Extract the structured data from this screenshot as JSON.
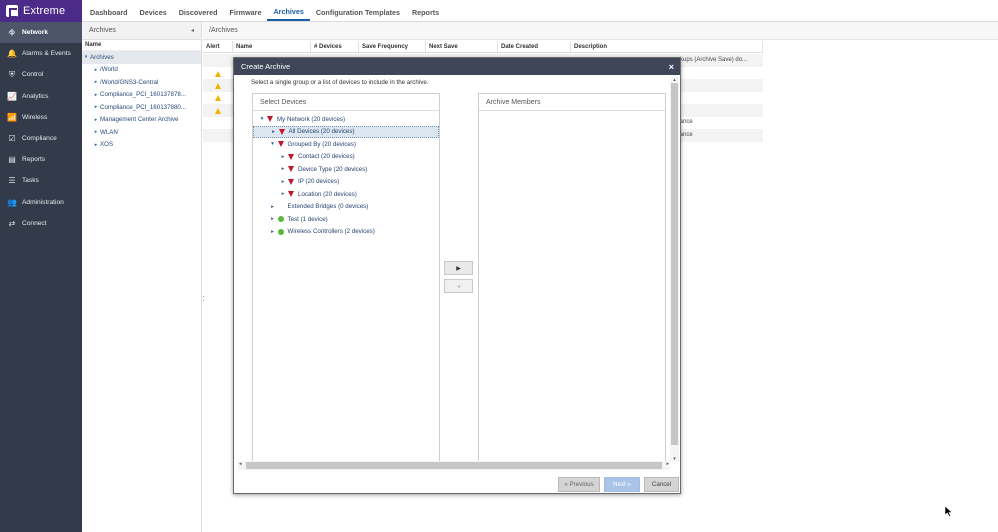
{
  "brand": {
    "name": "Extreme"
  },
  "sidebar": {
    "items": [
      {
        "label": "Network",
        "icon": "network-icon",
        "glyph": "⛗",
        "active": true
      },
      {
        "label": "Alarms & Events",
        "icon": "bell-icon",
        "glyph": "🔔",
        "active": false
      },
      {
        "label": "Control",
        "icon": "shield-icon",
        "glyph": "⛨",
        "active": false
      },
      {
        "label": "Analytics",
        "icon": "chart-icon",
        "glyph": "📈",
        "active": false
      },
      {
        "label": "Wireless",
        "icon": "wifi-icon",
        "glyph": "📶",
        "active": false
      },
      {
        "label": "Compliance",
        "icon": "check-icon",
        "glyph": "☑",
        "active": false
      },
      {
        "label": "Reports",
        "icon": "report-icon",
        "glyph": "▤",
        "active": false
      },
      {
        "label": "Tasks",
        "icon": "tasks-icon",
        "glyph": "☰",
        "active": false
      },
      {
        "label": "Administration",
        "icon": "users-icon",
        "glyph": "👥",
        "active": false
      },
      {
        "label": "Connect",
        "icon": "connect-icon",
        "glyph": "⇄",
        "active": false
      }
    ]
  },
  "top_tabs": [
    "Dashboard",
    "Devices",
    "Discovered",
    "Firmware",
    "Archives",
    "Configuration Templates",
    "Reports"
  ],
  "active_tab": "Archives",
  "archives_panel": {
    "title": "Archives",
    "collapse_glyph": "◂",
    "column": "Name",
    "root": "Archives",
    "items": [
      "/World",
      "/World/GNS3-Central",
      "Compliance_PCI_160137878...",
      "Compliance_PCI_160137880...",
      "Management Center Archive",
      "WLAN",
      "XOS"
    ]
  },
  "main": {
    "path": "/Archives",
    "columns": [
      "Alert",
      "Name",
      "# Devices",
      "Save Frequency",
      "Next Save",
      "Date Created",
      "Description"
    ],
    "visible_text": [
      "ckups (Archive Save) do...",
      "liance",
      "liance"
    ]
  },
  "modal": {
    "title": "Create Archive",
    "close_glyph": "×",
    "instruction": "Select a single group or a list of devices to include in the archive.",
    "left_header": "Select Devices",
    "right_header": "Archive Members",
    "tree": [
      {
        "label": "My Network (20 devices)",
        "level": 0,
        "arrow": "▾",
        "marker": "red"
      },
      {
        "label": "All Devices (20 devices)",
        "level": 1,
        "arrow": "▸",
        "marker": "red",
        "selected": true
      },
      {
        "label": "Grouped By (20 devices)",
        "level": 1,
        "arrow": "▾",
        "marker": "red"
      },
      {
        "label": "Contact (20 devices)",
        "level": 2,
        "arrow": "▸",
        "marker": "red"
      },
      {
        "label": "Device Type (20 devices)",
        "level": 2,
        "arrow": "▸",
        "marker": "red"
      },
      {
        "label": "IP (20 devices)",
        "level": 2,
        "arrow": "▸",
        "marker": "red"
      },
      {
        "label": "Location (20 devices)",
        "level": 2,
        "arrow": "▸",
        "marker": "red"
      },
      {
        "label": "Extended Bridges (0 devices)",
        "level": 1,
        "arrow": "▸",
        "marker": "none"
      },
      {
        "label": "Test (1 device)",
        "level": 1,
        "arrow": "▸",
        "marker": "green"
      },
      {
        "label": "Wireless Controllers (2 devices)",
        "level": 1,
        "arrow": "▸",
        "marker": "green"
      }
    ],
    "add_glyph": "▶",
    "remove_glyph": "◂",
    "buttons": {
      "previous": "« Previous",
      "next": "Next »",
      "cancel": "Cancel"
    }
  }
}
